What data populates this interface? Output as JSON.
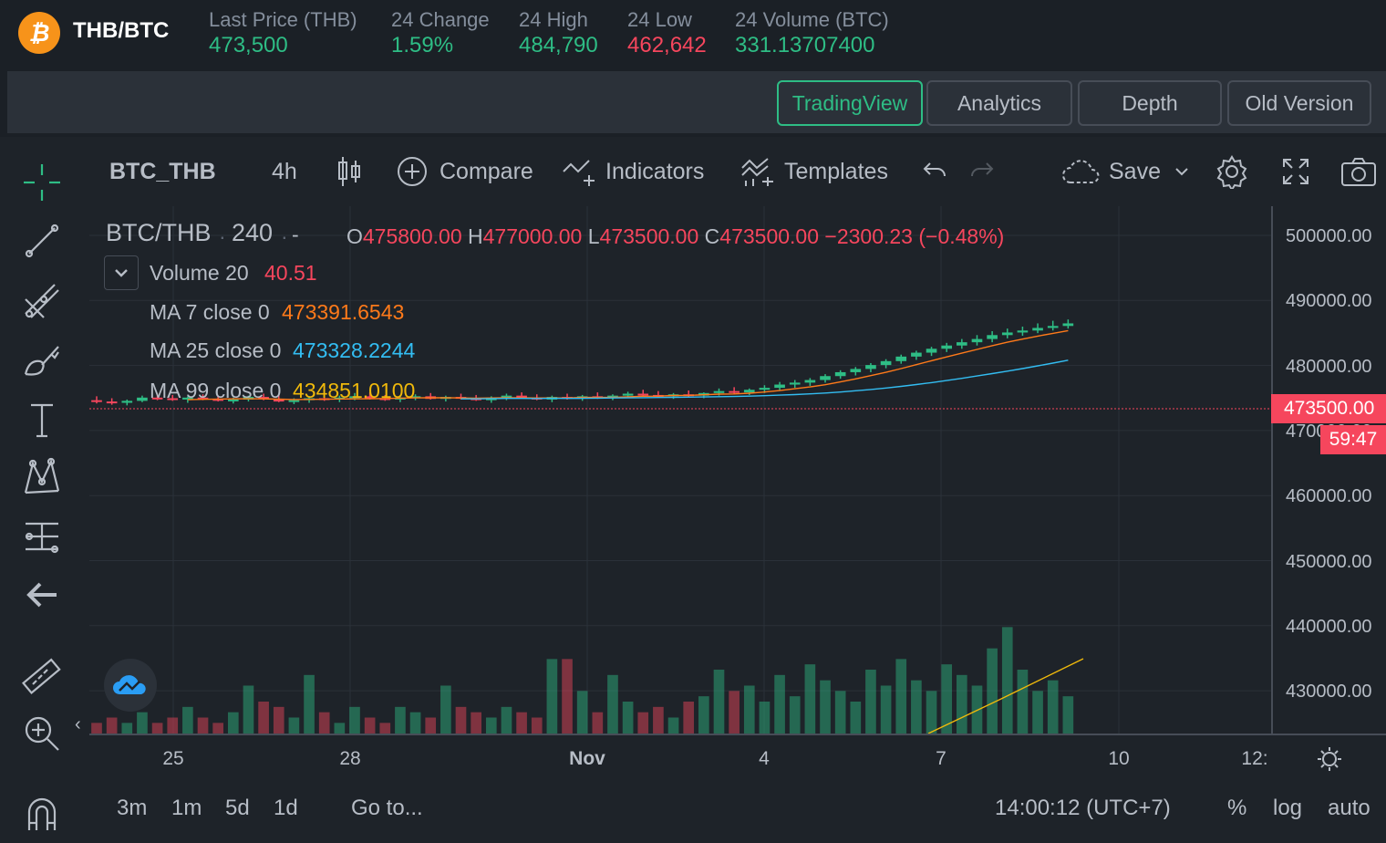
{
  "ticker": {
    "logo_glyph": "₿",
    "pair": "THB/BTC",
    "stats": [
      {
        "label": "Last Price (THB)",
        "value": "473,500",
        "color": "green"
      },
      {
        "label": "24 Change",
        "value": "1.59%",
        "color": "green"
      },
      {
        "label": "24 High",
        "value": "484,790",
        "color": "green"
      },
      {
        "label": "24 Low",
        "value": "462,642",
        "color": "red"
      },
      {
        "label": "24 Volume (BTC)",
        "value": "331.13707400",
        "color": "green"
      }
    ]
  },
  "tabs": [
    {
      "label": "TradingView",
      "active": true
    },
    {
      "label": "Analytics",
      "active": false
    },
    {
      "label": "Depth",
      "active": false
    },
    {
      "label": "Old Version",
      "active": false
    }
  ],
  "toolbar": {
    "symbol": "BTC_THB",
    "interval": "4h",
    "compare": "Compare",
    "indicators": "Indicators",
    "templates": "Templates",
    "save": "Save"
  },
  "legend": {
    "title": "BTC/THB",
    "interval": "240",
    "dash": "-",
    "ohlc": {
      "o": "475800.00",
      "h": "477000.00",
      "l": "473500.00",
      "c": "473500.00",
      "change": "−2300.23 (−0.48%)"
    },
    "volume": {
      "label": "Volume 20",
      "value": "40.51"
    },
    "ma7": {
      "label": "MA 7 close 0",
      "value": "473391.6543",
      "color": "#ff7a1a"
    },
    "ma25": {
      "label": "MA 25 close 0",
      "value": "473328.2244",
      "color": "#33bdf2"
    },
    "ma99": {
      "label": "MA 99 close 0",
      "value": "434851.0100",
      "color": "#f0b90b"
    }
  },
  "price_axis": {
    "ticks": [
      "500000.00",
      "490000.00",
      "480000.00",
      "470000.00",
      "460000.00",
      "450000.00",
      "440000.00",
      "430000.00"
    ],
    "current": "473500.00",
    "countdown": "59:47"
  },
  "time_axis": {
    "ticks": [
      "25",
      "28",
      "Nov",
      "4",
      "7",
      "10",
      "12:"
    ]
  },
  "bottom": {
    "ranges": [
      "3m",
      "1m",
      "5d",
      "1d"
    ],
    "goto": "Go to...",
    "clock": "14:00:12 (UTC+7)",
    "percent": "%",
    "log": "log",
    "auto": "auto"
  },
  "colors": {
    "up": "#2ebd85",
    "down": "#f6465d",
    "accent": "#2ebd85"
  },
  "chart_data": {
    "type": "candlestick",
    "y_range": [
      423000,
      504000
    ],
    "candles": [
      {
        "o": 474200,
        "h": 474800,
        "l": 473700,
        "c": 474000,
        "v": 2
      },
      {
        "o": 474000,
        "h": 474500,
        "l": 473500,
        "c": 473800,
        "v": 3
      },
      {
        "o": 473800,
        "h": 474300,
        "l": 473400,
        "c": 474100,
        "v": 2
      },
      {
        "o": 474100,
        "h": 474900,
        "l": 473900,
        "c": 474600,
        "v": 4
      },
      {
        "o": 474600,
        "h": 475200,
        "l": 474200,
        "c": 474500,
        "v": 2
      },
      {
        "o": 474500,
        "h": 475000,
        "l": 474100,
        "c": 474300,
        "v": 3
      },
      {
        "o": 474300,
        "h": 474800,
        "l": 473800,
        "c": 474600,
        "v": 5
      },
      {
        "o": 474600,
        "h": 475100,
        "l": 474200,
        "c": 474400,
        "v": 3
      },
      {
        "o": 474400,
        "h": 474900,
        "l": 474000,
        "c": 474100,
        "v": 2
      },
      {
        "o": 474100,
        "h": 474600,
        "l": 473700,
        "c": 474300,
        "v": 4
      },
      {
        "o": 474300,
        "h": 474900,
        "l": 474000,
        "c": 474700,
        "v": 9
      },
      {
        "o": 474700,
        "h": 475200,
        "l": 474200,
        "c": 474400,
        "v": 6
      },
      {
        "o": 474400,
        "h": 474900,
        "l": 473900,
        "c": 474000,
        "v": 5
      },
      {
        "o": 474000,
        "h": 474500,
        "l": 473600,
        "c": 474200,
        "v": 3
      },
      {
        "o": 474200,
        "h": 474800,
        "l": 473800,
        "c": 474500,
        "v": 11
      },
      {
        "o": 474500,
        "h": 475000,
        "l": 474100,
        "c": 474300,
        "v": 4
      },
      {
        "o": 474300,
        "h": 474900,
        "l": 473900,
        "c": 474600,
        "v": 2
      },
      {
        "o": 474600,
        "h": 475300,
        "l": 474200,
        "c": 474800,
        "v": 5
      },
      {
        "o": 474800,
        "h": 475400,
        "l": 474300,
        "c": 474500,
        "v": 3
      },
      {
        "o": 474500,
        "h": 475000,
        "l": 474100,
        "c": 474300,
        "v": 2
      },
      {
        "o": 474300,
        "h": 474800,
        "l": 473900,
        "c": 474600,
        "v": 5
      },
      {
        "o": 474600,
        "h": 475100,
        "l": 474200,
        "c": 474800,
        "v": 4
      },
      {
        "o": 474800,
        "h": 475300,
        "l": 474300,
        "c": 474400,
        "v": 3
      },
      {
        "o": 474400,
        "h": 474900,
        "l": 474000,
        "c": 474700,
        "v": 9
      },
      {
        "o": 474700,
        "h": 475200,
        "l": 474300,
        "c": 474500,
        "v": 5
      },
      {
        "o": 474500,
        "h": 475000,
        "l": 474100,
        "c": 474200,
        "v": 4
      },
      {
        "o": 474200,
        "h": 474800,
        "l": 473800,
        "c": 474600,
        "v": 3
      },
      {
        "o": 474600,
        "h": 475200,
        "l": 474200,
        "c": 474900,
        "v": 5
      },
      {
        "o": 474900,
        "h": 475400,
        "l": 474500,
        "c": 474600,
        "v": 4
      },
      {
        "o": 474600,
        "h": 475100,
        "l": 474200,
        "c": 474300,
        "v": 3
      },
      {
        "o": 474300,
        "h": 474900,
        "l": 473900,
        "c": 474700,
        "v": 14
      },
      {
        "o": 474700,
        "h": 475200,
        "l": 474300,
        "c": 474500,
        "v": 14
      },
      {
        "o": 474500,
        "h": 475000,
        "l": 474100,
        "c": 474800,
        "v": 8
      },
      {
        "o": 474800,
        "h": 475400,
        "l": 474400,
        "c": 474600,
        "v": 4
      },
      {
        "o": 474600,
        "h": 475100,
        "l": 474200,
        "c": 474900,
        "v": 11
      },
      {
        "o": 474900,
        "h": 475500,
        "l": 474500,
        "c": 475200,
        "v": 6
      },
      {
        "o": 475200,
        "h": 475800,
        "l": 474800,
        "c": 475000,
        "v": 4
      },
      {
        "o": 475000,
        "h": 475600,
        "l": 474600,
        "c": 474800,
        "v": 5
      },
      {
        "o": 474800,
        "h": 475300,
        "l": 474400,
        "c": 475100,
        "v": 3
      },
      {
        "o": 475100,
        "h": 475700,
        "l": 474700,
        "c": 474900,
        "v": 6
      },
      {
        "o": 474900,
        "h": 475400,
        "l": 474500,
        "c": 475300,
        "v": 7
      },
      {
        "o": 475300,
        "h": 476000,
        "l": 474900,
        "c": 475600,
        "v": 12
      },
      {
        "o": 475600,
        "h": 476200,
        "l": 475200,
        "c": 475400,
        "v": 8
      },
      {
        "o": 475400,
        "h": 476000,
        "l": 475000,
        "c": 475800,
        "v": 9
      },
      {
        "o": 475800,
        "h": 476500,
        "l": 475300,
        "c": 476100,
        "v": 6
      },
      {
        "o": 476100,
        "h": 477000,
        "l": 475700,
        "c": 476600,
        "v": 11
      },
      {
        "o": 476600,
        "h": 477300,
        "l": 476100,
        "c": 476900,
        "v": 7
      },
      {
        "o": 476900,
        "h": 477600,
        "l": 476400,
        "c": 477300,
        "v": 13
      },
      {
        "o": 477300,
        "h": 478200,
        "l": 476900,
        "c": 477900,
        "v": 10
      },
      {
        "o": 477900,
        "h": 478800,
        "l": 477500,
        "c": 478500,
        "v": 8
      },
      {
        "o": 478500,
        "h": 479300,
        "l": 478000,
        "c": 479000,
        "v": 6
      },
      {
        "o": 479000,
        "h": 479900,
        "l": 478500,
        "c": 479600,
        "v": 12
      },
      {
        "o": 479600,
        "h": 480500,
        "l": 479100,
        "c": 480200,
        "v": 9
      },
      {
        "o": 480200,
        "h": 481200,
        "l": 479800,
        "c": 480900,
        "v": 14
      },
      {
        "o": 480900,
        "h": 481800,
        "l": 480400,
        "c": 481500,
        "v": 10
      },
      {
        "o": 481500,
        "h": 482400,
        "l": 481000,
        "c": 482100,
        "v": 8
      },
      {
        "o": 482100,
        "h": 483000,
        "l": 481600,
        "c": 482600,
        "v": 13
      },
      {
        "o": 482600,
        "h": 483600,
        "l": 482100,
        "c": 483100,
        "v": 11
      },
      {
        "o": 483100,
        "h": 484200,
        "l": 482600,
        "c": 483600,
        "v": 9
      },
      {
        "o": 483600,
        "h": 484800,
        "l": 483100,
        "c": 484200,
        "v": 16
      },
      {
        "o": 484200,
        "h": 485200,
        "l": 483700,
        "c": 484600,
        "v": 20
      },
      {
        "o": 484600,
        "h": 485500,
        "l": 484100,
        "c": 484900,
        "v": 12
      },
      {
        "o": 484900,
        "h": 486000,
        "l": 484500,
        "c": 485300,
        "v": 8
      },
      {
        "o": 485300,
        "h": 486400,
        "l": 484900,
        "c": 485600,
        "v": 10
      },
      {
        "o": 485600,
        "h": 486600,
        "l": 485200,
        "c": 486000,
        "v": 7
      }
    ]
  }
}
